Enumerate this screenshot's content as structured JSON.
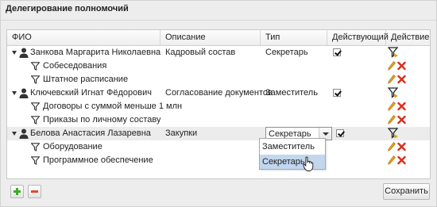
{
  "window": {
    "title": "Делегирование полномочий"
  },
  "grid": {
    "columns": [
      "ФИО",
      "Описание",
      "Тип",
      "Действующий",
      "Действие"
    ],
    "rows": [
      {
        "fio": "Занкова Маргарита Николаевна",
        "desc": "Кадровый состав",
        "type": "Секретарь",
        "active": true
      },
      {
        "fio": "Собеседования"
      },
      {
        "fio": "Штатное расписание"
      },
      {
        "fio": "Ключевский Игнат Фёдорович",
        "desc": "Согласование документов",
        "type": "Заместитель",
        "active": true
      },
      {
        "fio": "Договоры с суммой меньше 1 млн"
      },
      {
        "fio": "Приказы по личному составу"
      },
      {
        "fio": "Белова Анастасия Лазаревна",
        "desc": "Закупки",
        "type": "Секретарь",
        "active": true
      },
      {
        "fio": "Оборудование"
      },
      {
        "fio": "Программное обеспечение"
      }
    ]
  },
  "type_dropdown": {
    "selected": "Секретарь",
    "options": [
      "Заместитель",
      "Секретарь"
    ],
    "highlighted": "Секретарь"
  },
  "footer": {
    "save_label": "Сохранить"
  },
  "icons": {
    "user": "user-icon",
    "filter": "filter-icon",
    "edit": "pencil-icon",
    "delete": "delete-icon",
    "delegate": "delegate-filter-icon",
    "add": "plus-icon",
    "remove": "minus-icon"
  },
  "colors": {
    "edit": "#e5a21a",
    "delete": "#d8301e",
    "add": "#3faa2a",
    "remove": "#e2492e",
    "highlight": "#c2d6ee"
  }
}
